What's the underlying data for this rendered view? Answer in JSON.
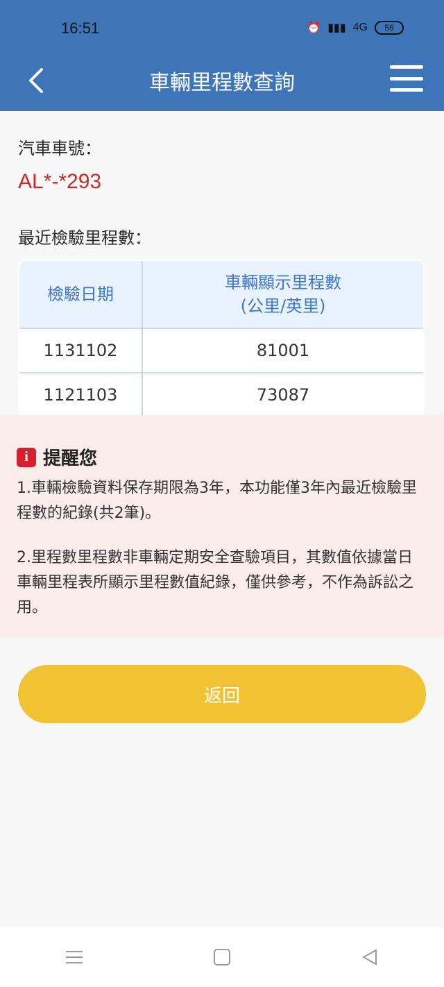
{
  "status_bar": {
    "time": "16:51",
    "network": "4G",
    "battery": "56"
  },
  "header": {
    "title": "車輛里程數查詢"
  },
  "main": {
    "plate_label": "汽車車號：",
    "plate_number": "AL*-*293",
    "mileage_label": "最近檢驗里程數：",
    "table": {
      "columns": [
        "檢驗日期",
        "車輛顯示里程數",
        "(公里/英里)"
      ],
      "rows": [
        [
          "1131102",
          "81001"
        ],
        [
          "1121103",
          "73087"
        ]
      ]
    }
  },
  "reminder": {
    "title": "提醒您",
    "items": [
      "1.車輛檢驗資料保存期限為3年，本功能僅3年內最近檢驗里程數的紀錄(共2筆)。",
      "2.里程數里程數非車輛定期安全查驗項目，其數值依據當日車輛里程表所顯示里程數值紀錄，僅供參考，不作為訴訟之用。"
    ]
  },
  "buttons": {
    "return_label": "返回"
  },
  "colors": {
    "header_bg": "#3e74b8",
    "plate_red": "#cc2b2b",
    "table_header_bg": "#e9f2ff",
    "table_header_text": "#3f78c8",
    "reminder_bg": "#fbecec",
    "return_button": "#f1c234"
  },
  "icons": {
    "back": "chevron-left-icon",
    "menu": "hamburger-menu-icon",
    "info": "info-icon",
    "nav": [
      "recent-apps-icon",
      "home-icon",
      "back-triangle-icon"
    ]
  }
}
